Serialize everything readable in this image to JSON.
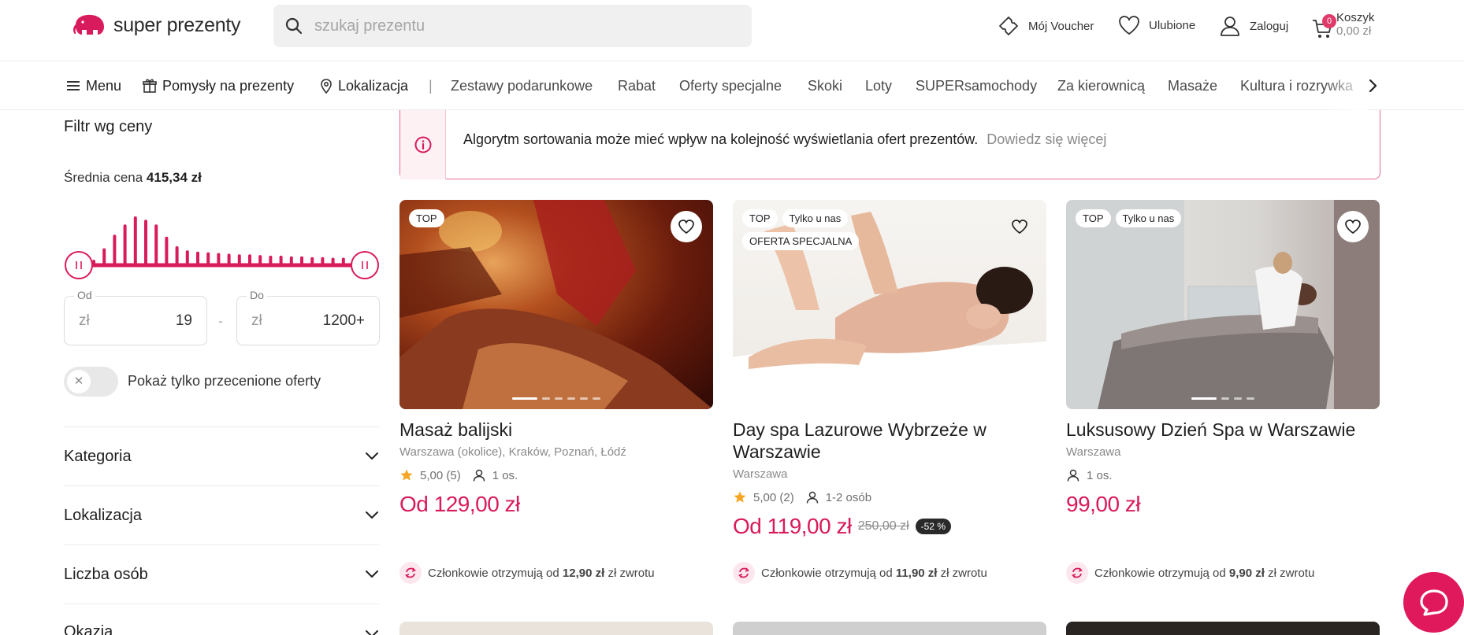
{
  "header": {
    "logo_text": "super prezenty",
    "search_placeholder": "szukaj prezentu",
    "voucher_label": "Mój Voucher",
    "favorites_label": "Ulubione",
    "login_label": "Zaloguj",
    "cart": {
      "label": "Koszyk",
      "amount": "0,00 zł",
      "count": "0"
    },
    "brand_color": "#d81b5c"
  },
  "nav": {
    "menu": "Menu",
    "ideas": "Pomysły na prezenty",
    "location": "Lokalizacja",
    "separator": "|",
    "items": [
      "Zestawy podarunkowe",
      "Rabat",
      "Oferty specjalne",
      "Skoki",
      "Loty",
      "SUPERsamochody",
      "Za kierownicą",
      "Masaże",
      "Kultura i rozrywka"
    ]
  },
  "sidebar": {
    "filter_title": "Filtr wg ceny",
    "avg_label": "Średnia cena",
    "avg_value": "415,34 zł",
    "histogram": [
      8,
      25,
      45,
      60,
      72,
      67,
      60,
      42,
      28,
      22,
      20,
      19,
      18,
      17,
      16,
      16,
      15,
      14,
      14,
      13,
      13,
      12,
      12,
      11,
      11,
      10
    ],
    "from": {
      "label": "Od",
      "currency": "zł",
      "value": "19"
    },
    "range_sep": "-",
    "to": {
      "label": "Do",
      "currency": "zł",
      "value": "1200+"
    },
    "toggle_label": "Pokaż tylko przecenione oferty",
    "toggle_on": false,
    "accordions": [
      "Kategoria",
      "Lokalizacja",
      "Liczba osób",
      "Okazja"
    ]
  },
  "info_banner": {
    "text": "Algorytm sortowania może mieć wpływ na kolejność wyświetlania ofert prezentów.",
    "link": "Dowiedz się więcej"
  },
  "products": [
    {
      "badges": [
        "TOP"
      ],
      "title": "Masaż balijski",
      "location": "Warszawa (okolice), Kraków, Poznań, Łódź",
      "rating": "5,00 (5)",
      "people": "1 os.",
      "price": "Od 129,00 zł",
      "old_price": "",
      "discount": "",
      "cashback_prefix": "Członkowie otrzymują od",
      "cashback_amount": "12,90 zł",
      "cashback_suffix": "zł zwrotu"
    },
    {
      "badges": [
        "TOP",
        "Tylko u nas",
        "OFERTA SPECJALNA"
      ],
      "title": "Day spa Lazurowe Wybrzeże w Warszawie",
      "location": "Warszawa",
      "rating": "5,00 (2)",
      "people": "1-2 osób",
      "price": "Od 119,00 zł",
      "old_price": "250,00 zł",
      "discount": "-52 %",
      "cashback_prefix": "Członkowie otrzymują od",
      "cashback_amount": "11,90 zł",
      "cashback_suffix": "zł zwrotu"
    },
    {
      "badges": [
        "TOP",
        "Tylko u nas"
      ],
      "title": "Luksusowy Dzień Spa w Warszawie",
      "location": "Warszawa",
      "rating": "",
      "people": "1 os.",
      "price": "99,00 zł",
      "old_price": "",
      "discount": "",
      "cashback_prefix": "Członkowie otrzymują od",
      "cashback_amount": "9,90 zł",
      "cashback_suffix": "zł zwrotu"
    }
  ]
}
